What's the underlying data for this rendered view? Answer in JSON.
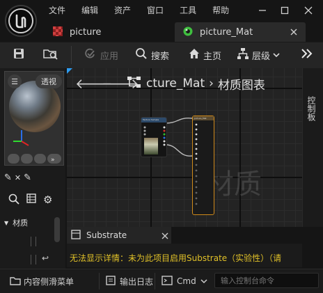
{
  "menu": [
    "文件",
    "编辑",
    "资产",
    "窗口",
    "工具",
    "帮助"
  ],
  "tabs": [
    {
      "label": "picture"
    },
    {
      "label": "picture_Mat"
    }
  ],
  "toolbar": {
    "apply_label": "应用",
    "search_label": "搜索",
    "home_label": "主页",
    "hierarchy_label": "层级"
  },
  "viewport": {
    "perspective_label": "透视"
  },
  "left_panel": {
    "category_label": "材质"
  },
  "graph": {
    "breadcrumb_asset": "cture_Mat",
    "breadcrumb_graph": "材质图表",
    "watermark": "材质",
    "texture_node_title": "Texture Sample",
    "material_node_title": "picture_Mat"
  },
  "right_panel": {
    "label": "控制板"
  },
  "substrate": {
    "title": "Substrate",
    "message": "无法显示详情：未为此项目启用Substrate（实验性）（请"
  },
  "bottom_bar": {
    "content_drawer": "内容侧滑菜单",
    "output_log": "输出日志",
    "cmd": "Cmd",
    "console_placeholder": "输入控制台命令"
  },
  "colors": {
    "accent_green": "#3fbf3f",
    "material_node_border": "#d08a1a",
    "warning_text": "#e0c028",
    "graph_corner": "#2e9cf0"
  }
}
